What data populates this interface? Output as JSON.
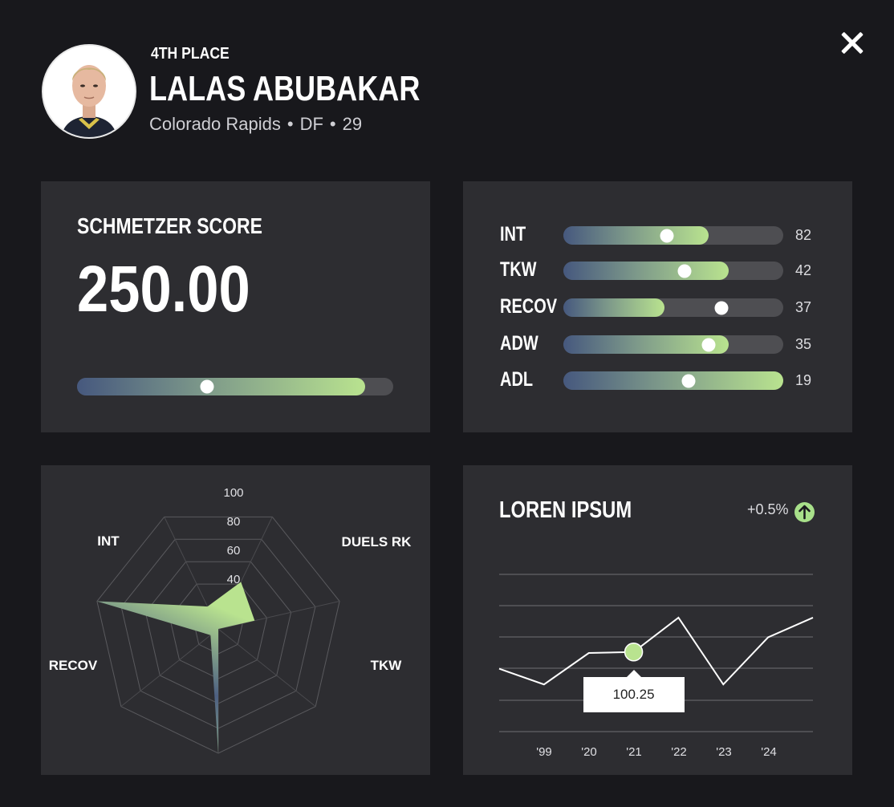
{
  "header": {
    "rank": "4TH PLACE",
    "name": "LALAS ABUBAKAR",
    "team": "Colorado Rapids",
    "position": "DF",
    "age": "29",
    "separator": "•"
  },
  "score_card": {
    "label": "SCHMETZER SCORE",
    "value": "250.00",
    "bar_fill": 0.91,
    "knob": 0.41
  },
  "stat_bars": [
    {
      "label": "INT",
      "value": "82",
      "fill": 0.66,
      "knob": 0.47
    },
    {
      "label": "TKW",
      "value": "42",
      "fill": 0.75,
      "knob": 0.55
    },
    {
      "label": "RECOV",
      "value": "37",
      "fill": 0.46,
      "knob": 0.72
    },
    {
      "label": "ADW",
      "value": "35",
      "fill": 0.75,
      "knob": 0.66
    },
    {
      "label": "ADL",
      "value": "19",
      "fill": 1.0,
      "knob": 0.57
    }
  ],
  "chart_data": [
    {
      "type": "radar",
      "axes": [
        "DUELS RK",
        "TKW",
        "",
        "",
        "RECOV",
        "INT",
        ""
      ],
      "values": [
        42,
        30,
        0,
        100,
        8,
        100,
        20
      ],
      "ticks": [
        "100",
        "80",
        "60",
        "40"
      ],
      "range": [
        0,
        100
      ]
    },
    {
      "type": "line",
      "title": "LOREN IPSUM",
      "delta": "+0.5%",
      "categories": [
        "'99",
        "'20",
        "'21",
        "'22",
        "'23",
        "'24"
      ],
      "values": [
        96,
        92,
        100,
        100.25,
        109,
        92,
        104,
        109
      ],
      "highlight": {
        "label": "100.25",
        "index": 3
      },
      "ylim": [
        80,
        120
      ],
      "grid": true
    }
  ],
  "colors": {
    "background": "#18181c",
    "card": "#2d2d31",
    "accent_green": "#b9e38f",
    "accent_blue": "#46587e"
  }
}
